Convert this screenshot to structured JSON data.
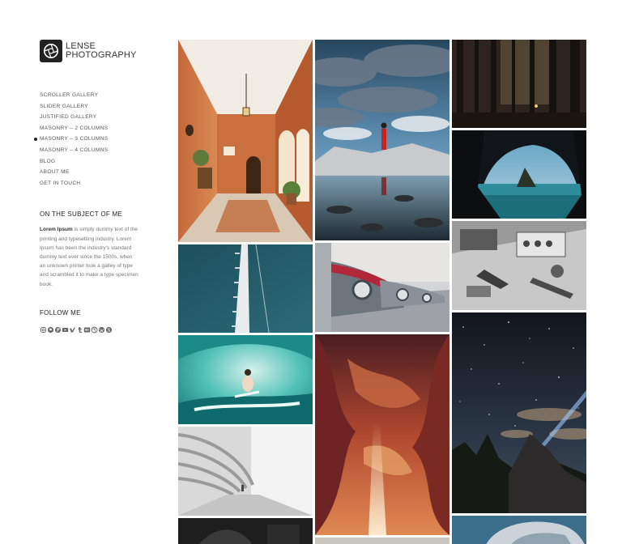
{
  "brand": {
    "line1": "LENSE",
    "line2": "PHOTOGRAPHY"
  },
  "menu": [
    {
      "label": "SCROLLER GALLERY",
      "active": false
    },
    {
      "label": "SLIDER GALLERY",
      "active": false
    },
    {
      "label": "JUSTIFIED GALLERY",
      "active": false
    },
    {
      "label": "MASONRY – 2 COLUMNS",
      "active": false
    },
    {
      "label": "MASONRY – 3 COLUMNS",
      "active": true
    },
    {
      "label": "MASONRY – 4 COLUMNS",
      "active": false
    },
    {
      "label": "BLOG",
      "active": false
    },
    {
      "label": "ABOUT ME",
      "active": false
    },
    {
      "label": "GET IN TOUCH",
      "active": false
    }
  ],
  "about": {
    "title": "ON THE SUBJECT OF ME",
    "lead": "Lorem Ipsum",
    "body": " is simply dummy text of the printing and typesetting industry. Lorem Ipsum has been the industry's standard dummy text ever since the 1500s, when an unknown printer took a galley of type and scrambled it to make a type specimen book."
  },
  "follow": {
    "title": "FOLLOW ME",
    "icons": [
      "instagram-icon",
      "github-icon",
      "pinterest-icon",
      "youtube-icon",
      "vimeo-icon",
      "tumblr-icon",
      "flickr-icon",
      "dribbble-icon",
      "wordpress-icon",
      "skype-icon"
    ]
  },
  "gallery": [
    [
      {
        "name": "photo-interior-corridor"
      },
      {
        "name": "photo-pier-aerial"
      },
      {
        "name": "photo-surfer-wave"
      },
      {
        "name": "photo-white-arches"
      },
      {
        "name": "photo-dark-bottom"
      }
    ],
    [
      {
        "name": "photo-lake-reflection"
      },
      {
        "name": "photo-vintage-cars"
      },
      {
        "name": "photo-antelope-canyon"
      },
      {
        "name": "photo-bottom-strip"
      }
    ],
    [
      {
        "name": "photo-forest-night"
      },
      {
        "name": "photo-sea-cave"
      },
      {
        "name": "photo-workshop-bw"
      },
      {
        "name": "photo-night-sky"
      },
      {
        "name": "photo-rocky-shore"
      }
    ]
  ]
}
